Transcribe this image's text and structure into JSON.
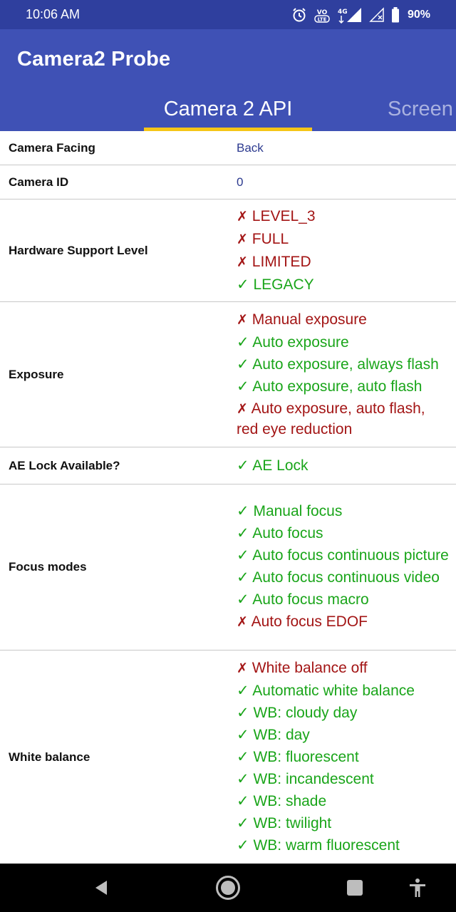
{
  "status_bar": {
    "time": "10:06 AM",
    "battery_percent": "90%",
    "icons": [
      "alarm-icon",
      "volte-icon",
      "lte-signal-icon",
      "no-signal-icon",
      "battery-icon"
    ],
    "volte_label": "VO LTE",
    "network_label": "4G"
  },
  "app": {
    "title": "Camera2 Probe"
  },
  "tabs": [
    {
      "label": "Camera 2 API",
      "active": true
    },
    {
      "label": "Screen",
      "active": false
    }
  ],
  "colors": {
    "status_bar": "#2f3f9e",
    "primary": "#3f51b5",
    "indicator": "#f5c518",
    "supported": "#1aa51a",
    "unsupported": "#a31515",
    "value_text": "#2c3a8f"
  },
  "marks": {
    "yes": "✓",
    "no": "✗"
  },
  "rows": [
    {
      "label": "Camera Facing",
      "value": "Back"
    },
    {
      "label": "Camera ID",
      "value": "0"
    },
    {
      "label": "Hardware Support Level",
      "caps": [
        {
          "text": "LEVEL_3",
          "ok": false
        },
        {
          "text": "FULL",
          "ok": false
        },
        {
          "text": "LIMITED",
          "ok": false
        },
        {
          "text": "LEGACY",
          "ok": true
        }
      ]
    },
    {
      "label": "Exposure",
      "caps": [
        {
          "text": "Manual exposure",
          "ok": false
        },
        {
          "text": "Auto exposure",
          "ok": true
        },
        {
          "text": "Auto exposure, always flash",
          "ok": true
        },
        {
          "text": "Auto exposure, auto flash",
          "ok": true
        },
        {
          "text": "Auto exposure, auto flash, red eye reduction",
          "ok": false
        }
      ]
    },
    {
      "label": "AE Lock Available?",
      "caps": [
        {
          "text": "AE Lock",
          "ok": true
        }
      ]
    },
    {
      "label": "Focus modes",
      "caps": [
        {
          "text": "Manual focus",
          "ok": true
        },
        {
          "text": "Auto focus",
          "ok": true
        },
        {
          "text": "Auto focus continuous picture",
          "ok": true
        },
        {
          "text": "Auto focus continuous video",
          "ok": true
        },
        {
          "text": "Auto focus macro",
          "ok": true
        },
        {
          "text": "Auto focus EDOF",
          "ok": false
        }
      ]
    },
    {
      "label": "White balance",
      "caps": [
        {
          "text": "White balance off",
          "ok": false
        },
        {
          "text": "Automatic white balance",
          "ok": true
        },
        {
          "text": "WB: cloudy day",
          "ok": true
        },
        {
          "text": "WB: day",
          "ok": true
        },
        {
          "text": "WB: fluorescent",
          "ok": true
        },
        {
          "text": "WB: incandescent",
          "ok": true
        },
        {
          "text": "WB: shade",
          "ok": true
        },
        {
          "text": "WB: twilight",
          "ok": true
        },
        {
          "text": "WB: warm fluorescent",
          "ok": true
        }
      ]
    }
  ],
  "nav_bar": {
    "buttons": [
      "back-icon",
      "home-icon",
      "recents-icon",
      "accessibility-icon"
    ]
  }
}
